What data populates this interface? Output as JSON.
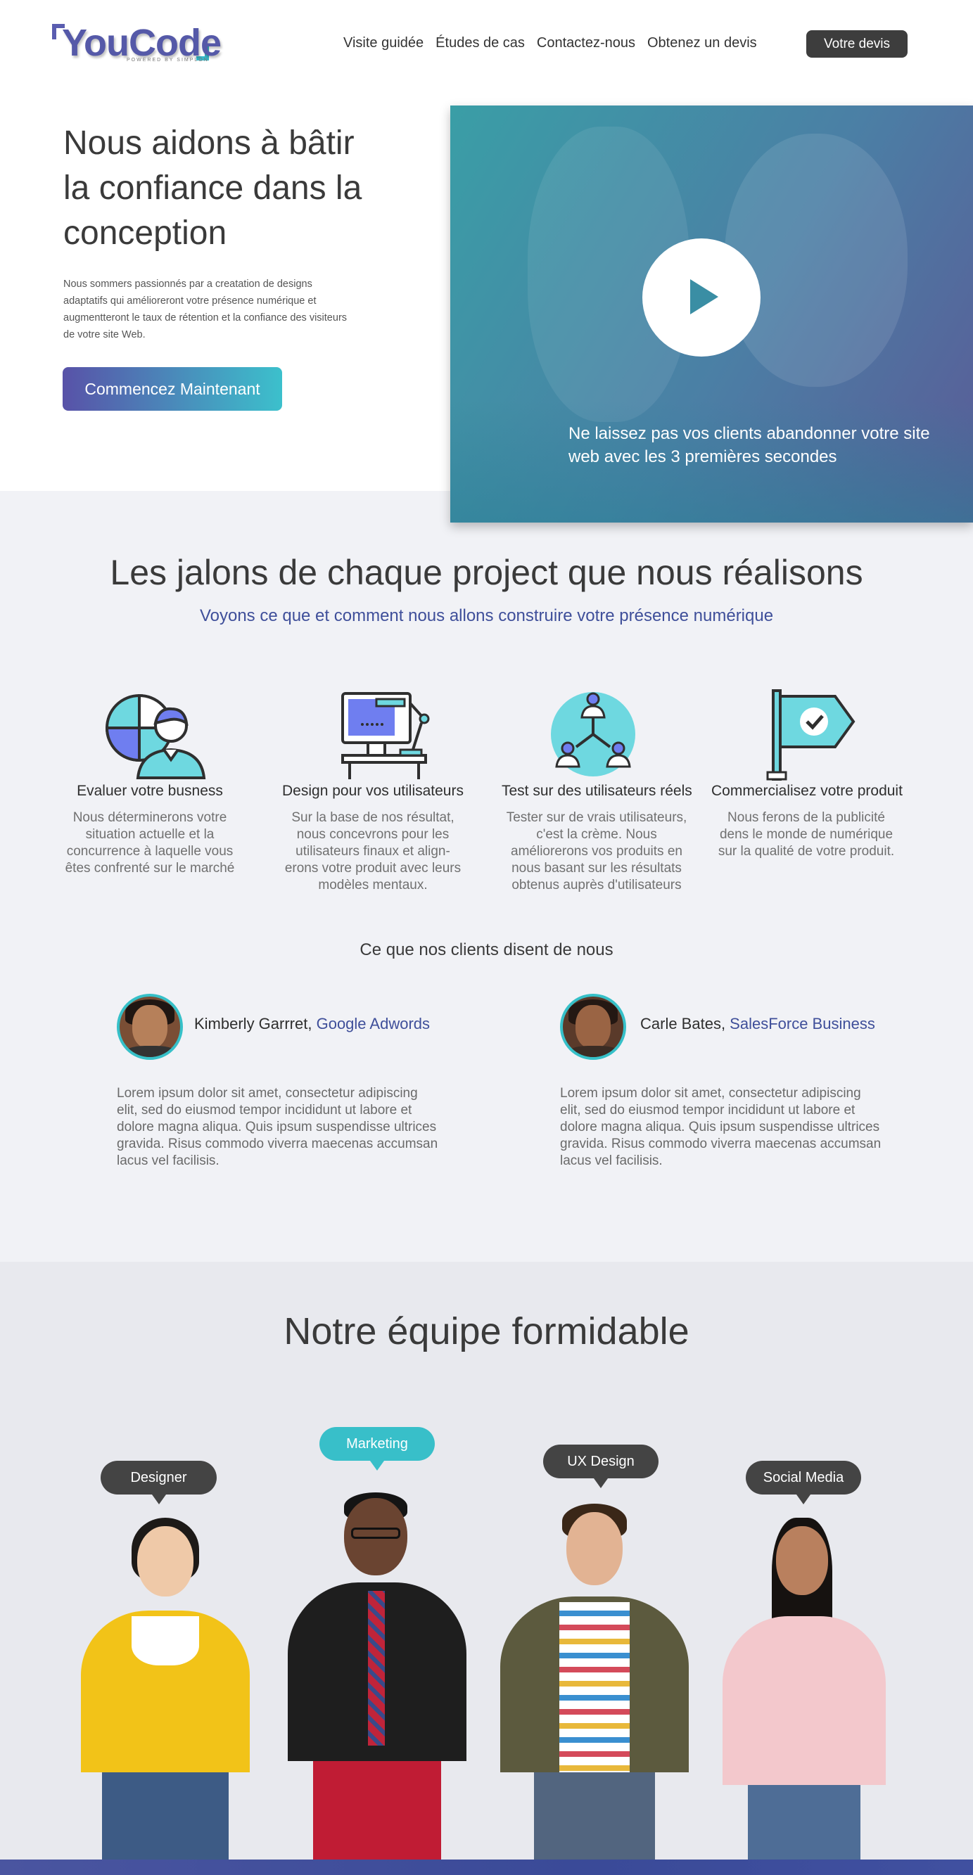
{
  "header": {
    "logo": {
      "word": "YouCode",
      "tagline": "POWERED BY SIMPLON"
    },
    "nav": [
      "Visite guidée",
      "Études de cas",
      "Contactez-nous",
      "Obtenez un devis"
    ],
    "cta_label": "Votre devis"
  },
  "hero": {
    "title": "Nous aidons à bâtir la confiance dans la conception",
    "text": "Nous sommers passionnés par a creatation de designs adaptatifs qui amélioreront votre présence numérique et augmentteront le taux de rétention et la confiance des visiteurs de votre site Web.",
    "button_label": "Commencez Maintenant",
    "video_caption": "Ne laissez pas vos clients abandonner votre site web avec les 3 premières secondes"
  },
  "milestones": {
    "title": "Les jalons de chaque project que nous réalisons",
    "subtitle": "Voyons ce que et comment nous allons construire votre présence numérique",
    "items": [
      {
        "icon": "person-analytics-icon",
        "title": "Evaluer votre busness",
        "text": "Nous déterminerons votre situation actuelle et la concurrence à laquelle vous êtes confrenté sur le marché"
      },
      {
        "icon": "desktop-design-icon",
        "title": "Design pour vos utilisateurs",
        "text": "Sur la base de nos résultat, nous concevrons pour les utilisateurs finaux et align-erons votre produit avec leurs modèles mentaux."
      },
      {
        "icon": "user-network-icon",
        "title": "Test sur des utilisateurs réels",
        "text": "Tester sur de vrais utilisateurs, c'est la crème. Nous améliorerons vos produits en nous basant sur les résultats obtenus auprès d'utilisateurs"
      },
      {
        "icon": "flag-check-icon",
        "title": "Commercialisez votre produit",
        "text": "Nous ferons de la publicité dens le monde de numérique sur la qualité de votre produit."
      }
    ]
  },
  "testimonials": {
    "title": "Ce que nos clients disent de nous",
    "items": [
      {
        "name": "Kimberly Garrret, ",
        "company": "Google Adwords",
        "text": "Lorem ipsum dolor sit amet, consectetur adipiscing elit, sed do eiusmod tempor incididunt ut labore et dolore magna aliqua. Quis ipsum suspendisse ultrices gravida. Risus commodo viverra maecenas accumsan lacus vel facilisis."
      },
      {
        "name": "Carle Bates, ",
        "company": "SalesForce Business",
        "text": "Lorem ipsum dolor sit amet, consectetur adipiscing elit, sed do eiusmod tempor incididunt ut labore et dolore magna aliqua. Quis ipsum suspendisse ultrices gravida. Risus commodo viverra maecenas accumsan lacus vel facilisis."
      }
    ]
  },
  "team": {
    "title": "Notre équipe formidable",
    "members": [
      {
        "role": "Designer",
        "bubble_color": "#444444"
      },
      {
        "role": "Marketing",
        "bubble_color": "#38bfc9"
      },
      {
        "role": "UX Design",
        "bubble_color": "#444444"
      },
      {
        "role": "Social Media",
        "bubble_color": "#444444"
      }
    ]
  },
  "colors": {
    "brand": "#5559a8",
    "accent": "#38bfc9",
    "link": "#3f4f9a",
    "dark": "#3d3d3d"
  }
}
